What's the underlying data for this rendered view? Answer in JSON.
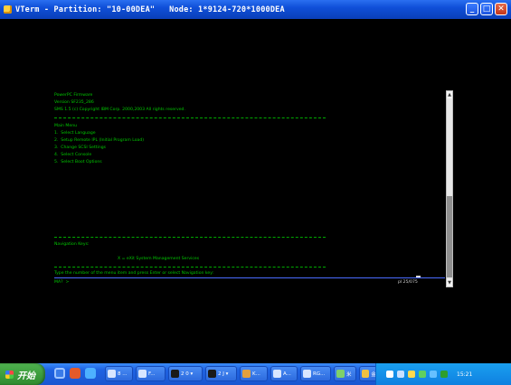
{
  "window": {
    "title": "VTerm - Partition: \"10-00DEA\"   Node: 1*9124-720*1000DEA",
    "minimize": "_",
    "maximize": "□",
    "close": "✕",
    "icon": "terminal-app-icon"
  },
  "console": {
    "header": [
      "PowerPC Firmware",
      "Version SF235_286",
      "SMS 1.5 (c) Copyright IBM Corp. 2000,2003 All rights reserved."
    ],
    "menu_title": "Main Menu",
    "menu_items": [
      "1.  Select Language",
      "2.  Setup Remote IPL (Initial Program Load)",
      "3.  Change SCSI Settings",
      "4.  Select Console",
      "5.  Select Boot Options"
    ],
    "nav_title": "Navigation Keys:",
    "nav_hint": "X = eXit System Management Services",
    "instruction": "Type the number of the menu item and press Enter or select Navigation key:",
    "prompt": "MA?  >",
    "status": "pl  25/075"
  },
  "taskbar": {
    "start_label": "开始",
    "tasks": [
      {
        "label": "8 ...",
        "icon": "folder-icon"
      },
      {
        "label": "F...",
        "icon": "folder-icon"
      },
      {
        "label": "2 0 ▾",
        "icon": "terminal-icon"
      },
      {
        "label": "2 J ▾",
        "icon": "terminal-icon"
      },
      {
        "label": "K...",
        "icon": "browser-icon"
      },
      {
        "label": "A...",
        "icon": "document-icon"
      },
      {
        "label": "RG...",
        "icon": "app-icon"
      },
      {
        "label": "米",
        "icon": "app-icon"
      },
      {
        "label": "金...",
        "icon": "app-icon"
      }
    ],
    "clock": "15:21"
  }
}
